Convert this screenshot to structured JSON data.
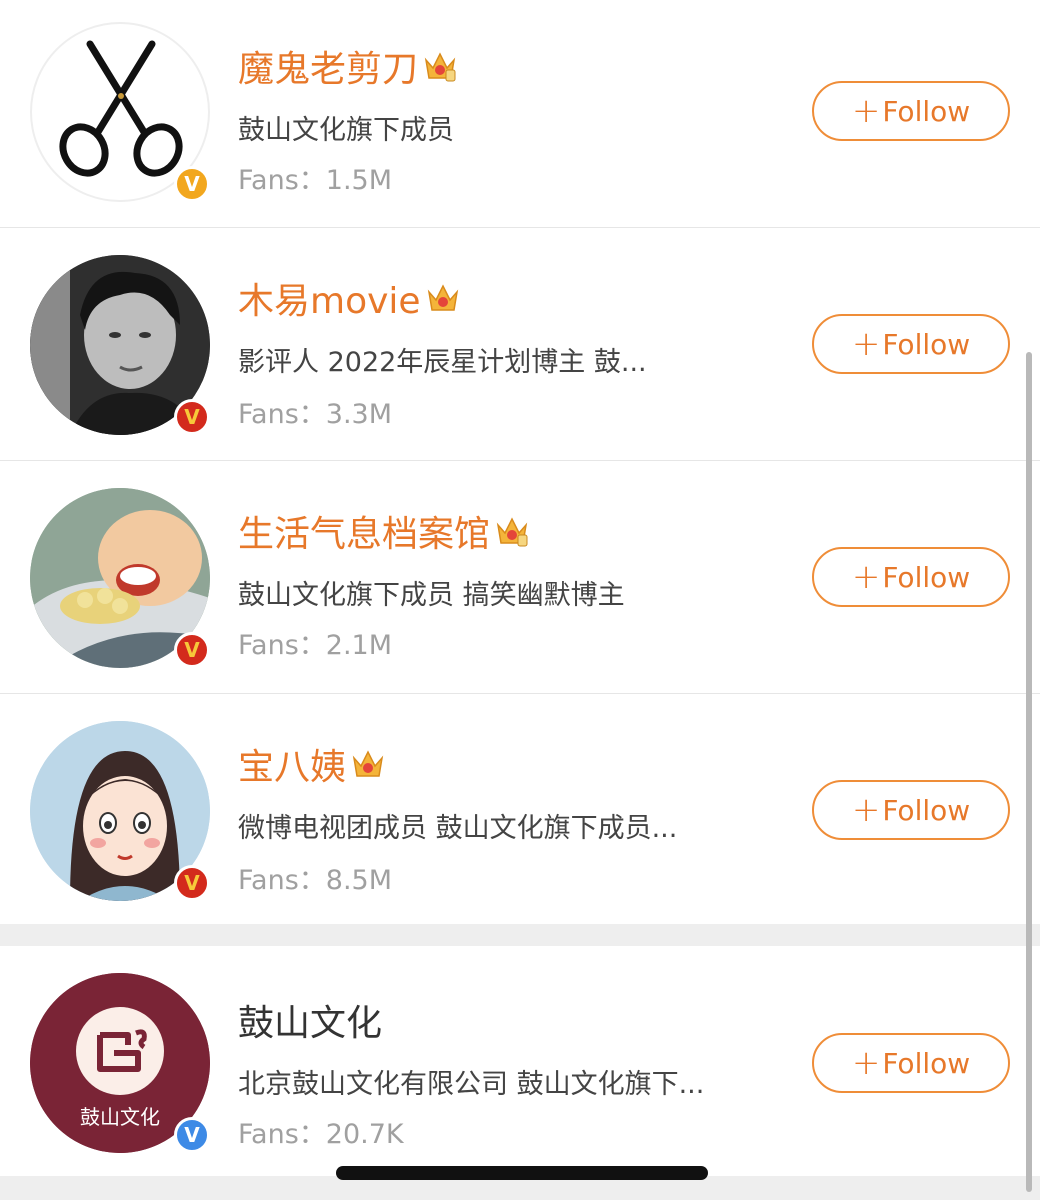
{
  "users": [
    {
      "name": "魔鬼老剪刀",
      "desc": "鼓山文化旗下成员",
      "fans": "Fans：1.5M",
      "follow": "Follow",
      "badge": "V"
    },
    {
      "name": "木易movie",
      "desc": "影评人  2022年辰星计划博主 鼓...",
      "fans": "Fans：3.3M",
      "follow": "Follow",
      "badge": "V"
    },
    {
      "name": "生活气息档案馆",
      "desc": "鼓山文化旗下成员 搞笑幽默博主",
      "fans": "Fans：2.1M",
      "follow": "Follow",
      "badge": "V"
    },
    {
      "name": "宝八姨",
      "desc": "微博电视团成员 鼓山文化旗下成员...",
      "fans": "Fans：8.5M",
      "follow": "Follow",
      "badge": "V"
    },
    {
      "name": "鼓山文化",
      "desc": "北京鼓山文化有限公司 鼓山文化旗下...",
      "fans": "Fans：20.7K",
      "follow": "Follow",
      "badge": "V",
      "logo_text": "鼓山文化"
    }
  ],
  "plus_symbol": "+",
  "colors": {
    "accent": "#e7782a",
    "button_border": "#ef8d38",
    "gold_v": "#f2a71e",
    "red_v": "#d32a1c",
    "blue_v": "#3d8ae6"
  }
}
